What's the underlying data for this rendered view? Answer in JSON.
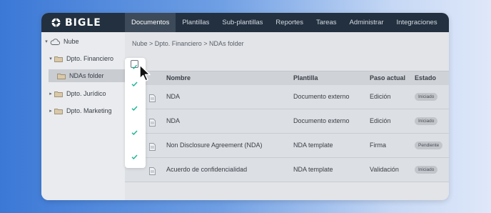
{
  "app": {
    "brand": "BIGLE",
    "accent_color": "#1ab394",
    "nav": [
      {
        "label": "Documentos",
        "active": true
      },
      {
        "label": "Plantillas",
        "active": false
      },
      {
        "label": "Sub-plantillas",
        "active": false
      },
      {
        "label": "Reportes",
        "active": false
      },
      {
        "label": "Tareas",
        "active": false
      },
      {
        "label": "Administrar",
        "active": false
      },
      {
        "label": "Integraciones",
        "active": false
      }
    ]
  },
  "sidebar": {
    "root": {
      "label": "Nube",
      "icon": "cloud-icon"
    },
    "items": [
      {
        "label": "Dpto. Financiero",
        "icon": "folder-icon",
        "expanded": true
      },
      {
        "label": "NDAs folder",
        "icon": "folder-icon",
        "selected": true
      },
      {
        "label": "Dpto. Jurídico",
        "icon": "folder-icon",
        "expanded": false
      },
      {
        "label": "Dpto. Marketing",
        "icon": "folder-icon",
        "expanded": false
      }
    ]
  },
  "breadcrumb": "Nube > Dpto. Financiero > NDAs folder",
  "table": {
    "columns": [
      "Nombre",
      "Plantilla",
      "Paso actual",
      "Estado"
    ],
    "rows": [
      {
        "name": "NDA",
        "template": "Documento externo",
        "step": "Edición",
        "status": "Iniciado",
        "checked": true
      },
      {
        "name": "NDA",
        "template": "Documento externo",
        "step": "Edición",
        "status": "Iniciado",
        "checked": true
      },
      {
        "name": "Non Disclosure Agreement (NDA)",
        "template": "NDA template",
        "step": "Firma",
        "status": "Pendiente",
        "checked": true
      },
      {
        "name": "Acuerdo de confidencialidad",
        "template": "NDA template",
        "step": "Validación",
        "status": "Iniciado",
        "checked": true
      }
    ],
    "select_all_checked": true
  }
}
